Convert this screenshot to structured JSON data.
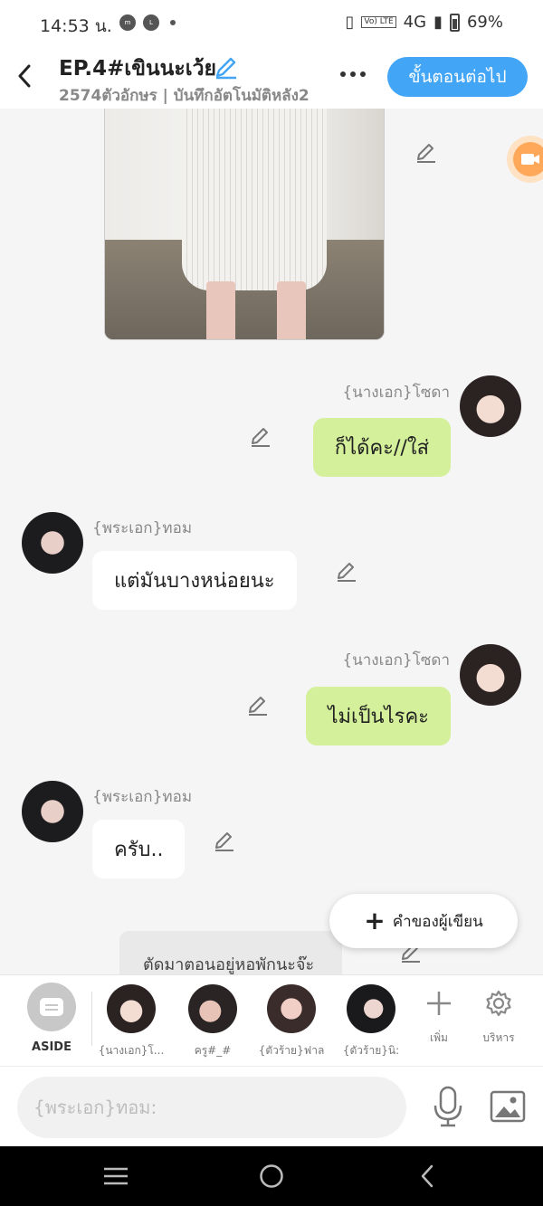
{
  "status_bar": {
    "time": "14:53 น.",
    "network": "4G",
    "lte": "Vo) LTE",
    "battery": "69%"
  },
  "header": {
    "title": "EP.4#เขินนะเว้ย",
    "subtitle": "2574ตัวอักษร | บันทึกอัตโนมัติหลัง2",
    "next_label": "ขั้นตอนต่อไป"
  },
  "messages": [
    {
      "sender": "{นางเอก}โซดา",
      "text": "ก็ได้คะ//ใส่"
    },
    {
      "sender": "{พระเอก}ทอม",
      "text": "แต่มันบางหน่อยนะ"
    },
    {
      "sender": "{นางเอก}โซดา",
      "text": "ไม่เป็นไรคะ"
    },
    {
      "sender": "{พระเอก}ทอม",
      "text": "ครับ.."
    }
  ],
  "aside_message": "ตัดมาตอนอยู่หอพักนะจ๊ะ",
  "writer_button": "คำของผู้เขียน",
  "char_bar": {
    "aside_label": "ASIDE",
    "characters": [
      {
        "label": "{นางเอก}โ..."
      },
      {
        "label": "ครู#_#"
      },
      {
        "label": "{ตัวร้าย}ฟาล"
      },
      {
        "label": "{ตัวร้าย}นิ:"
      }
    ],
    "add_label": "เพิ่ม",
    "manage_label": "บริหาร"
  },
  "input": {
    "placeholder": "{พระเอก}ทอม:"
  },
  "colors": {
    "accent": "#42a5f5",
    "my_bubble": "#d4f09b",
    "their_bubble": "#ffffff",
    "background": "#f5f5f5"
  }
}
